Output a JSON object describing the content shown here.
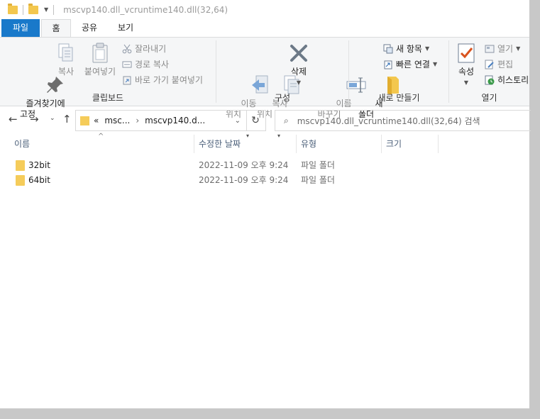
{
  "window": {
    "title": "mscvp140.dll_vcruntime140.dll(32,64)"
  },
  "tabs": {
    "file": "파일",
    "home": "홈",
    "share": "공유",
    "view": "보기"
  },
  "ribbon": {
    "clipboard": {
      "title": "클립보드",
      "pin": "즐겨찾기에\n고정",
      "copy": "복사",
      "paste": "붙여넣기",
      "cut": "잘라내기",
      "copy_path": "경로 복사",
      "paste_shortcut": "바로 가기 붙여넣기"
    },
    "organize": {
      "title": "구성",
      "move_to": "이동\n위치",
      "copy_to": "복사\n위치",
      "delete": "삭제",
      "rename": "이름\n바꾸기"
    },
    "new": {
      "title": "새로 만들기",
      "new_folder": "새\n폴더",
      "new_item": "새 항목",
      "easy_access": "빠른 연결"
    },
    "open": {
      "title": "열기",
      "properties": "속성",
      "open": "열기",
      "edit": "편집",
      "history": "히스토리"
    }
  },
  "address": {
    "crumb_prefix": "«",
    "crumb1": "msc...",
    "crumb_sep": "›",
    "crumb2": "mscvp140.d...",
    "search_placeholder": "mscvp140.dll_vcruntime140.dll(32,64) 검색"
  },
  "columns": {
    "name": "이름",
    "modified": "수정한 날짜",
    "type": "유형",
    "size": "크기"
  },
  "files": [
    {
      "name": "32bit",
      "modified": "2022-11-09 오후 9:24",
      "type": "파일 폴더"
    },
    {
      "name": "64bit",
      "modified": "2022-11-09 오후 9:24",
      "type": "파일 폴더"
    }
  ]
}
